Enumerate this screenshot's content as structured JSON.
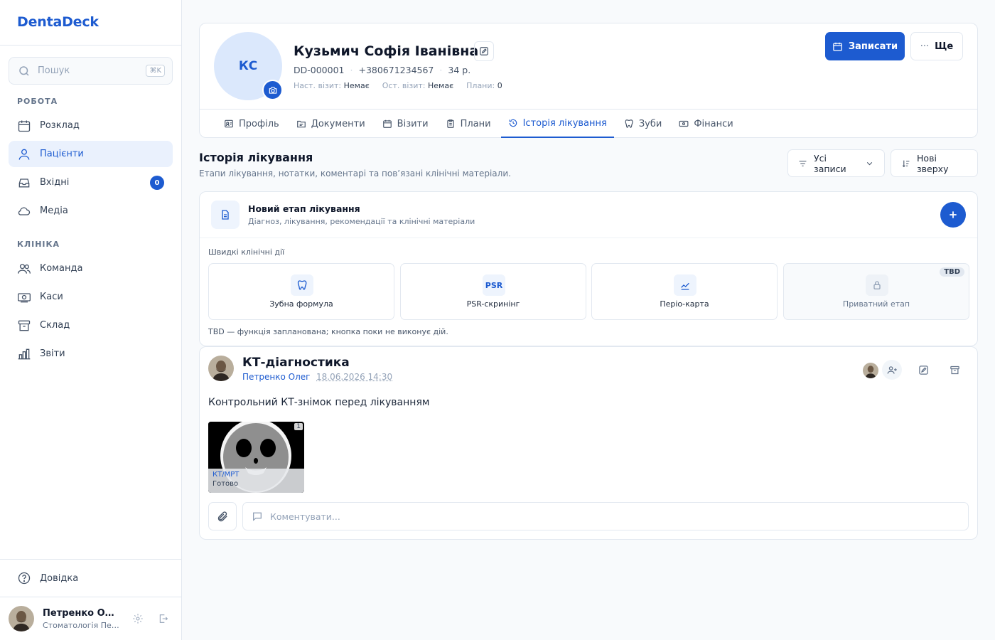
{
  "app": {
    "brand": "DentaDeck"
  },
  "search": {
    "placeholder": "Пошук",
    "shortcut": "⌘K"
  },
  "sidebar": {
    "work_title": "РОБОТА",
    "work_items": [
      {
        "label": "Розклад",
        "icon": "calendar-icon"
      },
      {
        "label": "Пацієнти",
        "icon": "users-icon",
        "active": true
      },
      {
        "label": "Вхідні",
        "icon": "inbox-icon",
        "badge": "0"
      },
      {
        "label": "Медіа",
        "icon": "cloud-icon"
      }
    ],
    "clinic_title": "КЛІНІКА",
    "clinic_items": [
      {
        "label": "Команда",
        "icon": "team-icon"
      },
      {
        "label": "Каси",
        "icon": "cash-icon"
      },
      {
        "label": "Склад",
        "icon": "archive-icon"
      },
      {
        "label": "Звіти",
        "icon": "chart-icon"
      }
    ],
    "help_label": "Довідка",
    "user": {
      "name": "Петренко Олег",
      "subtitle": "Стоматологія Петренка"
    }
  },
  "patient": {
    "initials": "КС",
    "name": "Кузьмич Софія Іванівна",
    "id": "DD-000001",
    "phone": "+380671234567",
    "age": "34 р.",
    "next_visit_label": "Наст. візит:",
    "next_visit_value": "Немає",
    "last_visit_label": "Ост. візит:",
    "last_visit_value": "Немає",
    "plans_label": "Плани:",
    "plans_value": "0"
  },
  "actions": {
    "book": "Записати",
    "more": "Ще"
  },
  "tabs": [
    {
      "label": "Профіль",
      "icon": "profile-icon"
    },
    {
      "label": "Документи",
      "icon": "folder-icon"
    },
    {
      "label": "Візити",
      "icon": "calendar-icon"
    },
    {
      "label": "Плани",
      "icon": "clipboard-icon"
    },
    {
      "label": "Історія лікування",
      "icon": "history-icon",
      "active": true
    },
    {
      "label": "Зуби",
      "icon": "tooth-icon"
    },
    {
      "label": "Фінанси",
      "icon": "money-icon"
    }
  ],
  "history": {
    "title": "Історія лікування",
    "subtitle": "Етапи лікування, нотатки, коментарі та пов’язані клінічні матеріали.",
    "filter_label": "Усі записи",
    "sort_label": "Нові зверху"
  },
  "new_stage": {
    "title": "Новий етап лікування",
    "subtitle": "Діагноз, лікування, рекомендації та клінічні матеріали",
    "quick_actions_label": "Швидкі клінічні дії",
    "quick_actions": [
      {
        "label": "Зубна формула",
        "icon": "tooth-icon"
      },
      {
        "label": "PSR-скринінг",
        "icon_text": "PSR"
      },
      {
        "label": "Періо-карта",
        "icon": "perio-chart-icon"
      },
      {
        "label": "Приватний етап",
        "icon": "lock-icon",
        "tag": "TBD",
        "disabled": true
      }
    ],
    "note": "TBD — функція запланована; кнопка поки не виконує дій."
  },
  "entry": {
    "title": "КТ-діагностика",
    "author": "Петренко Олег",
    "date": "18.06.2026 14:30",
    "text": "Контрольний КТ-знімок перед лікуванням",
    "attachment": {
      "count": "1",
      "type": "КТ/МРТ",
      "status": "Готово"
    },
    "comment_placeholder": "Коментувати..."
  },
  "colors": {
    "accent": "#1d5bd0",
    "accent_light": "#eaf1fd",
    "border": "#e2e8f0",
    "muted": "#64748b"
  }
}
